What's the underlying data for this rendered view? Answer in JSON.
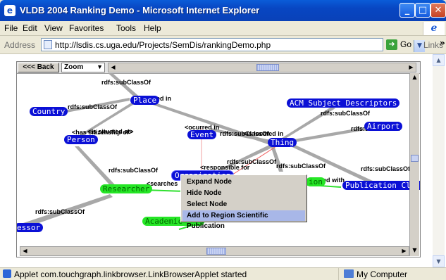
{
  "window": {
    "title": "VLDB 2004 Ranking Demo - Microsoft Internet Explorer",
    "controls": {
      "minimize": "_",
      "maximize": "□",
      "close": "✕"
    }
  },
  "menu": {
    "items": [
      "File",
      "Edit",
      "View",
      "Favorites",
      "Tools",
      "Help"
    ]
  },
  "address": {
    "label": "Address",
    "url": "http://lsdis.cs.uga.edu/Projects/SemDis/rankingDemo.php",
    "go": "Go",
    "links": "Links",
    "links_more": "»"
  },
  "applet": {
    "back_label": "<<< Back",
    "zoom_label": "Zoom"
  },
  "graph": {
    "nodes": {
      "place": "Place",
      "country": "Country",
      "person": "Person",
      "event": "Event",
      "thing": "Thing",
      "acm": "ACM Subject Descriptors",
      "airport": "Airport",
      "researcher": "Researcher",
      "organization": "Organization",
      "publication_class": "Publication Class",
      "partial_green": "ion",
      "professor": "essor",
      "academic": "Academic"
    },
    "edge_labels": {
      "place_sub": "rdfs:subClassOf",
      "located_in_place": "ted in",
      "country_sub": "rdfs:subClassOf",
      "person_sub": "rdfs:subClassOf",
      "has_citizenship": "<has citizenship of>",
      "situated_at": "<is situated at>",
      "occurred_in": "<ocurred in",
      "event_sub": "rdfs:subClassOf",
      "is_located_in": "<is located in",
      "thing_sub_acm": "rdfs:subClassOf",
      "airport_sub": "rdfs:subClassOf",
      "organization_sub": "rdfs:subClassOf",
      "responsible_for": "<responsible for",
      "researcher_sub": "rdfs:subClassOf",
      "thing_sub_mid": "rdfs:subClassOf",
      "pubclass_sub": "rdfs:subClassOf",
      "searches": "<searches",
      "published_with": "ed with",
      "professor_sub": "rdfs:subClassOf"
    }
  },
  "context_menu": {
    "items": [
      "Expand Node",
      "Hide Node",
      "Select Node",
      "Add to Region Scientific Publication"
    ]
  },
  "status": {
    "text": "Applet com.touchgraph.linkbrowser.LinkBrowserApplet started",
    "zone": "My Computer"
  },
  "colors": {
    "node_blue": "#0b10d6",
    "node_green": "#26e626",
    "title_blue": "#0846c2"
  }
}
